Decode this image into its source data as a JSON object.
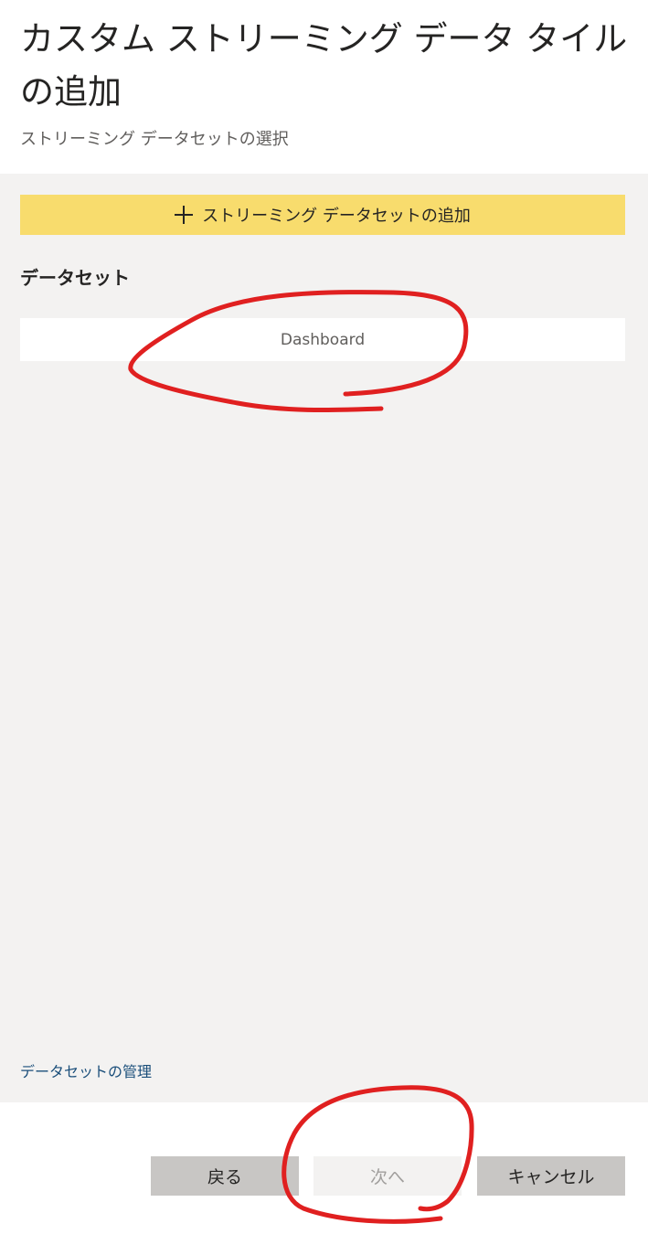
{
  "header": {
    "title": "カスタム ストリーミング データ タイルの追加",
    "subtitle": "ストリーミング データセットの選択"
  },
  "main": {
    "add_button_label": "ストリーミング データセットの追加",
    "add_button_icon": "plus-icon",
    "datasets_heading": "データセット",
    "datasets": [
      {
        "name": "Dashboard"
      }
    ],
    "manage_link": "データセットの管理"
  },
  "footer": {
    "back_label": "戻る",
    "next_label": "次へ",
    "cancel_label": "キャンセル"
  },
  "colors": {
    "accent_yellow": "#f8dc6d",
    "panel_bg": "#f3f2f1",
    "button_gray": "#c8c6c4",
    "link_blue": "#1a4e7a",
    "annotation_red": "#e02020"
  }
}
